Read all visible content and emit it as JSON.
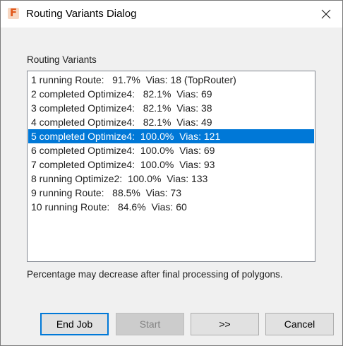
{
  "window": {
    "title": "Routing Variants Dialog",
    "app_icon": "F"
  },
  "group_label": "Routing Variants",
  "variants": [
    "1 running Route:   91.7%  Vias: 18 (TopRouter)",
    "2 completed Optimize4:   82.1%  Vias: 69",
    "3 completed Optimize4:   82.1%  Vias: 38",
    "4 completed Optimize4:   82.1%  Vias: 49",
    "5 completed Optimize4:  100.0%  Vias: 121",
    "6 completed Optimize4:  100.0%  Vias: 69",
    "7 completed Optimize4:  100.0%  Vias: 93",
    "8 running Optimize2:  100.0%  Vias: 133",
    "9 running Route:   88.5%  Vias: 73",
    "10 running Route:   84.6%  Vias: 60"
  ],
  "selected_index": 4,
  "note": "Percentage may decrease after final processing of polygons.",
  "buttons": {
    "end_job": "End Job",
    "start": "Start",
    "next": ">>",
    "cancel": "Cancel"
  },
  "colors": {
    "selection": "#0078d7",
    "app_icon_accent": "#e2591c"
  }
}
